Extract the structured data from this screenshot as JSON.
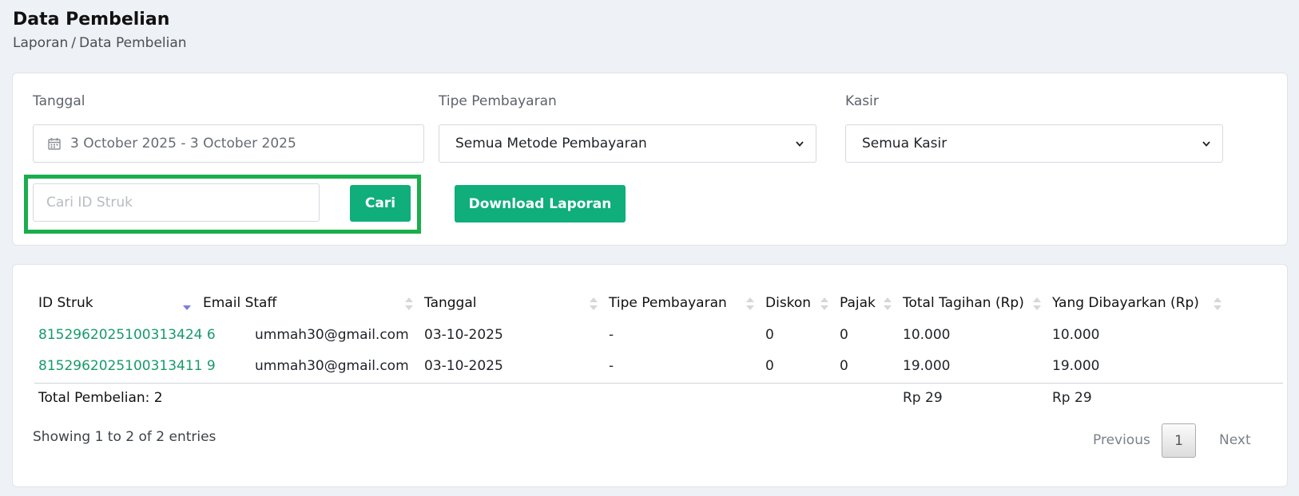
{
  "header": {
    "title": "Data Pembelian",
    "breadcrumb": [
      "Laporan",
      "Data Pembelian"
    ],
    "breadcrumb_separator": "/"
  },
  "filters": {
    "date_label": "Tanggal",
    "date_value": "3 October 2025 - 3 October 2025",
    "payment_label": "Tipe Pembayaran",
    "payment_selected": "Semua Metode Pembayaran",
    "cashier_label": "Kasir",
    "cashier_selected": "Semua Kasir",
    "search_placeholder": "Cari ID Struk",
    "search_value": "",
    "search_button": "Cari",
    "download_button": "Download Laporan"
  },
  "table": {
    "columns": [
      "ID Struk",
      "Email Staff",
      "Tanggal",
      "Tipe Pembayaran",
      "Diskon",
      "Pajak",
      "Total Tagihan (Rp)",
      "Yang Dibayarkan (Rp)"
    ],
    "rows": [
      [
        "8152962025100313424 6",
        "ummah30@gmail.com",
        "03-10-2025",
        "-",
        "0",
        "0",
        "10.000",
        "10.000"
      ],
      [
        "8152962025100313411 9",
        "ummah30@gmail.com",
        "03-10-2025",
        "-",
        "0",
        "0",
        "19.000",
        "19.000"
      ]
    ],
    "footer": {
      "label": "Total Pembelian: 2",
      "total_tagihan": "Rp 29",
      "total_dibayarkan": "Rp 29"
    },
    "info": "Showing 1 to 2 of 2 entries",
    "pagination": {
      "previous": "Previous",
      "current": "1",
      "next": "Next"
    }
  },
  "colors": {
    "accent": "#0fae7a",
    "link": "#179a6a",
    "highlight": "#1aae4b",
    "background": "#eef1f5"
  },
  "icons": {
    "date": "calendar-icon",
    "select": "chevron-down-icon",
    "sort": "sort-icon",
    "sort_active": "sort-desc-icon"
  }
}
